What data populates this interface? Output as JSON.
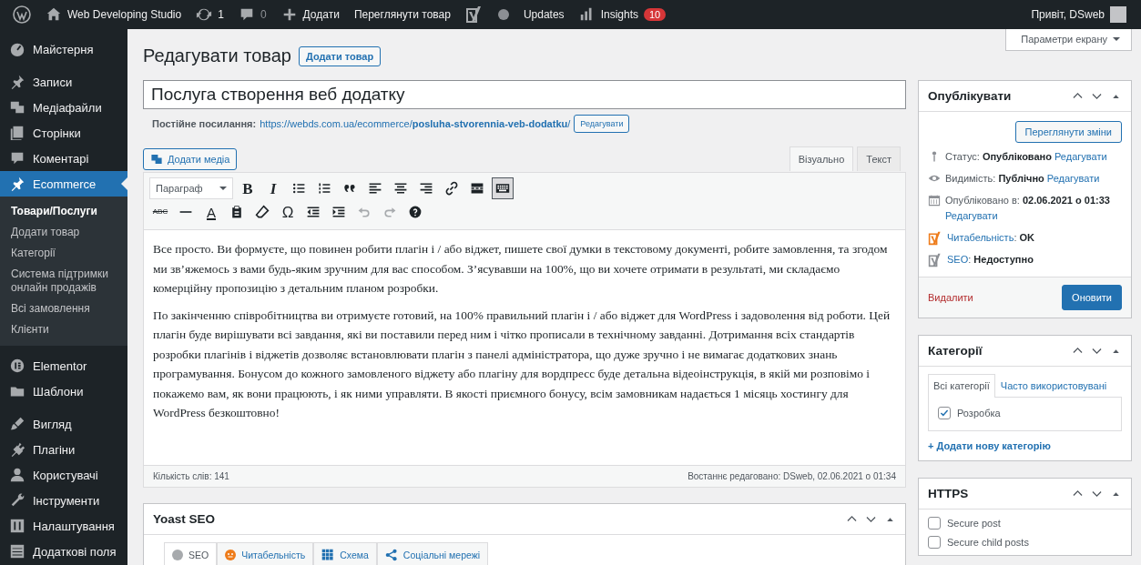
{
  "admin_bar": {
    "items": [
      {
        "kind": "logo"
      },
      {
        "kind": "site",
        "label": "Web Developing Studio"
      },
      {
        "kind": "updates",
        "label": "1"
      },
      {
        "kind": "comments",
        "label": "0"
      },
      {
        "kind": "new",
        "label": "Додати"
      },
      {
        "kind": "link",
        "label": "Переглянути товар"
      },
      {
        "kind": "yoast"
      },
      {
        "kind": "dot"
      },
      {
        "kind": "link",
        "label": "Updates"
      },
      {
        "kind": "insights",
        "label": "Insights",
        "badge": "10"
      }
    ],
    "greeting": "Привіт, DSweb"
  },
  "sidebar": {
    "items": [
      {
        "label": "Майстерня",
        "selected": false
      },
      {
        "label": "Записи",
        "selected": false
      },
      {
        "label": "Медіафайли",
        "selected": false
      },
      {
        "label": "Сторінки",
        "selected": false
      },
      {
        "label": "Коментарі",
        "selected": false
      },
      {
        "label": "Ecommerce",
        "selected": true,
        "children": [
          {
            "label": "Товари/Послуги",
            "selected": true
          },
          {
            "label": "Додати товар",
            "selected": false
          },
          {
            "label": "Категорії",
            "selected": false
          },
          {
            "label": "Система підтримки онлайн продажів",
            "selected": false
          },
          {
            "label": "Всі замовлення",
            "selected": false
          },
          {
            "label": "Клієнти",
            "selected": false
          }
        ]
      },
      {
        "label": "Elementor",
        "selected": false
      },
      {
        "label": "Шаблони",
        "selected": false
      },
      {
        "label": "Вигляд",
        "selected": false
      },
      {
        "label": "Плагіни",
        "selected": false
      },
      {
        "label": "Користувачі",
        "selected": false
      },
      {
        "label": "Інструменти",
        "selected": false
      },
      {
        "label": "Налаштування",
        "selected": false
      },
      {
        "label": "Додаткові поля",
        "selected": false
      }
    ]
  },
  "screen_options": "Параметри екрану",
  "heading": {
    "title": "Редагувати товар",
    "button": "Додати товар"
  },
  "editor": {
    "title_value": "Послуга створення веб додатку",
    "permalink": {
      "label": "Постійне посилання:",
      "url": "https://webds.com.ua/ecommerce/**posluha-stvorennia-veb-dodatku**/",
      "button": "Редагувати"
    },
    "media_button": "Додати медіа",
    "tabs": [
      {
        "label": "Візуально",
        "selected": true
      },
      {
        "label": "Текст",
        "selected": false
      }
    ],
    "format": "Параграф",
    "toolbar": [
      [
        {
          "kind": "bold",
          "text": "B"
        },
        {
          "kind": "italic",
          "text": "I"
        },
        {
          "kind": "ul"
        },
        {
          "kind": "ol"
        },
        {
          "kind": "quote"
        },
        {
          "kind": "align-left"
        },
        {
          "kind": "align-center"
        },
        {
          "kind": "align-right"
        },
        {
          "kind": "link"
        },
        {
          "kind": "more"
        },
        {
          "kind": "toolbar",
          "pressed": true
        }
      ],
      [
        {
          "kind": "strike",
          "text": "ABC"
        },
        {
          "kind": "hr"
        },
        {
          "kind": "color",
          "text": "A"
        },
        {
          "kind": "paste"
        },
        {
          "kind": "eraser"
        },
        {
          "kind": "special",
          "text": "Ω"
        },
        {
          "kind": "outdent"
        },
        {
          "kind": "indent"
        },
        {
          "kind": "undo",
          "disabled": true
        },
        {
          "kind": "redo",
          "disabled": true
        },
        {
          "kind": "help"
        }
      ]
    ],
    "paragraphs": [
      "Все просто. Ви формуєте, що повинен робити плагін і / або віджет, пишете свої думки в текстовому документі, робите замовлення, та згодом ми зв’яжемось з вами будь-яким зручним для вас способом. З’ясувавши на 100%, що ви хочете отримати в результаті, ми складаємо комерційну пропозицію з детальним планом розробки.",
      "По закінченню співробітництва ви отримуєте готовий, на 100% правильний плагін і / або віджет для WordPress і задоволення від роботи. Цей плагін буде вирішувати всі завдання, які ви поставили перед ним і чітко прописали в технічному завданні. Дотримання всіх стандартів розробки плагінів і віджетів дозволяє встановлювати плагін з панелі адміністратора, що дуже зручно і не вимагає додаткових знань програмування. Бонусом до кожного замовленого віджету або плагіну для вордпресс буде детальна відеоінструкція, в якій ми розповімо і покажемо вам, як вони працюють, і як ними управляти. В якості приємного бонусу, всім замовникам надається 1 місяць хостингу для WordPress безкоштовно!"
    ],
    "word_count": "Кількість слів: 141",
    "last_edited": "Востаннє редаговано: DSweb, 02.06.2021 о 01:34"
  },
  "yoast": {
    "title": "Yoast SEO",
    "tabs": [
      {
        "kind": "seo",
        "label": "SEO",
        "selected": true,
        "color": "#a7aaad"
      },
      {
        "kind": "readability",
        "label": "Читабельність",
        "selected": false,
        "color": "#ee7c1b"
      },
      {
        "kind": "schema",
        "label": "Схема",
        "selected": false
      },
      {
        "kind": "social",
        "label": "Соціальні мережі",
        "selected": false
      }
    ]
  },
  "publish": {
    "title": "Опублікувати",
    "preview_button": "Переглянути зміни",
    "rows": [
      {
        "kind": "status",
        "text": "Статус: **Опубліковано**",
        "link": "Редагувати"
      },
      {
        "kind": "visibility",
        "text": "Видимість: **Публічно**",
        "link": "Редагувати"
      },
      {
        "kind": "date",
        "text": "Опубліковано в: **02.06.2021 о 01:33**",
        "link": "Редагувати"
      },
      {
        "kind": "readability",
        "link": "Читабельність",
        "text": ": **OK**"
      },
      {
        "kind": "seo",
        "link": "SEO",
        "text": ": **Недоступно**"
      }
    ],
    "delete_link": "Видалити",
    "update_button": "Оновити"
  },
  "categories": {
    "title": "Категорії",
    "tabs": [
      {
        "label": "Всі категорії",
        "selected": true
      },
      {
        "label": "Часто використовувані",
        "selected": false
      }
    ],
    "items": [
      {
        "label": "Розробка",
        "checked": true
      }
    ],
    "add_link": "+ Додати нову категорію"
  },
  "https": {
    "title": "HTTPS",
    "options": [
      {
        "label": "Secure post",
        "checked": false
      },
      {
        "label": "Secure child posts",
        "checked": false
      }
    ]
  }
}
